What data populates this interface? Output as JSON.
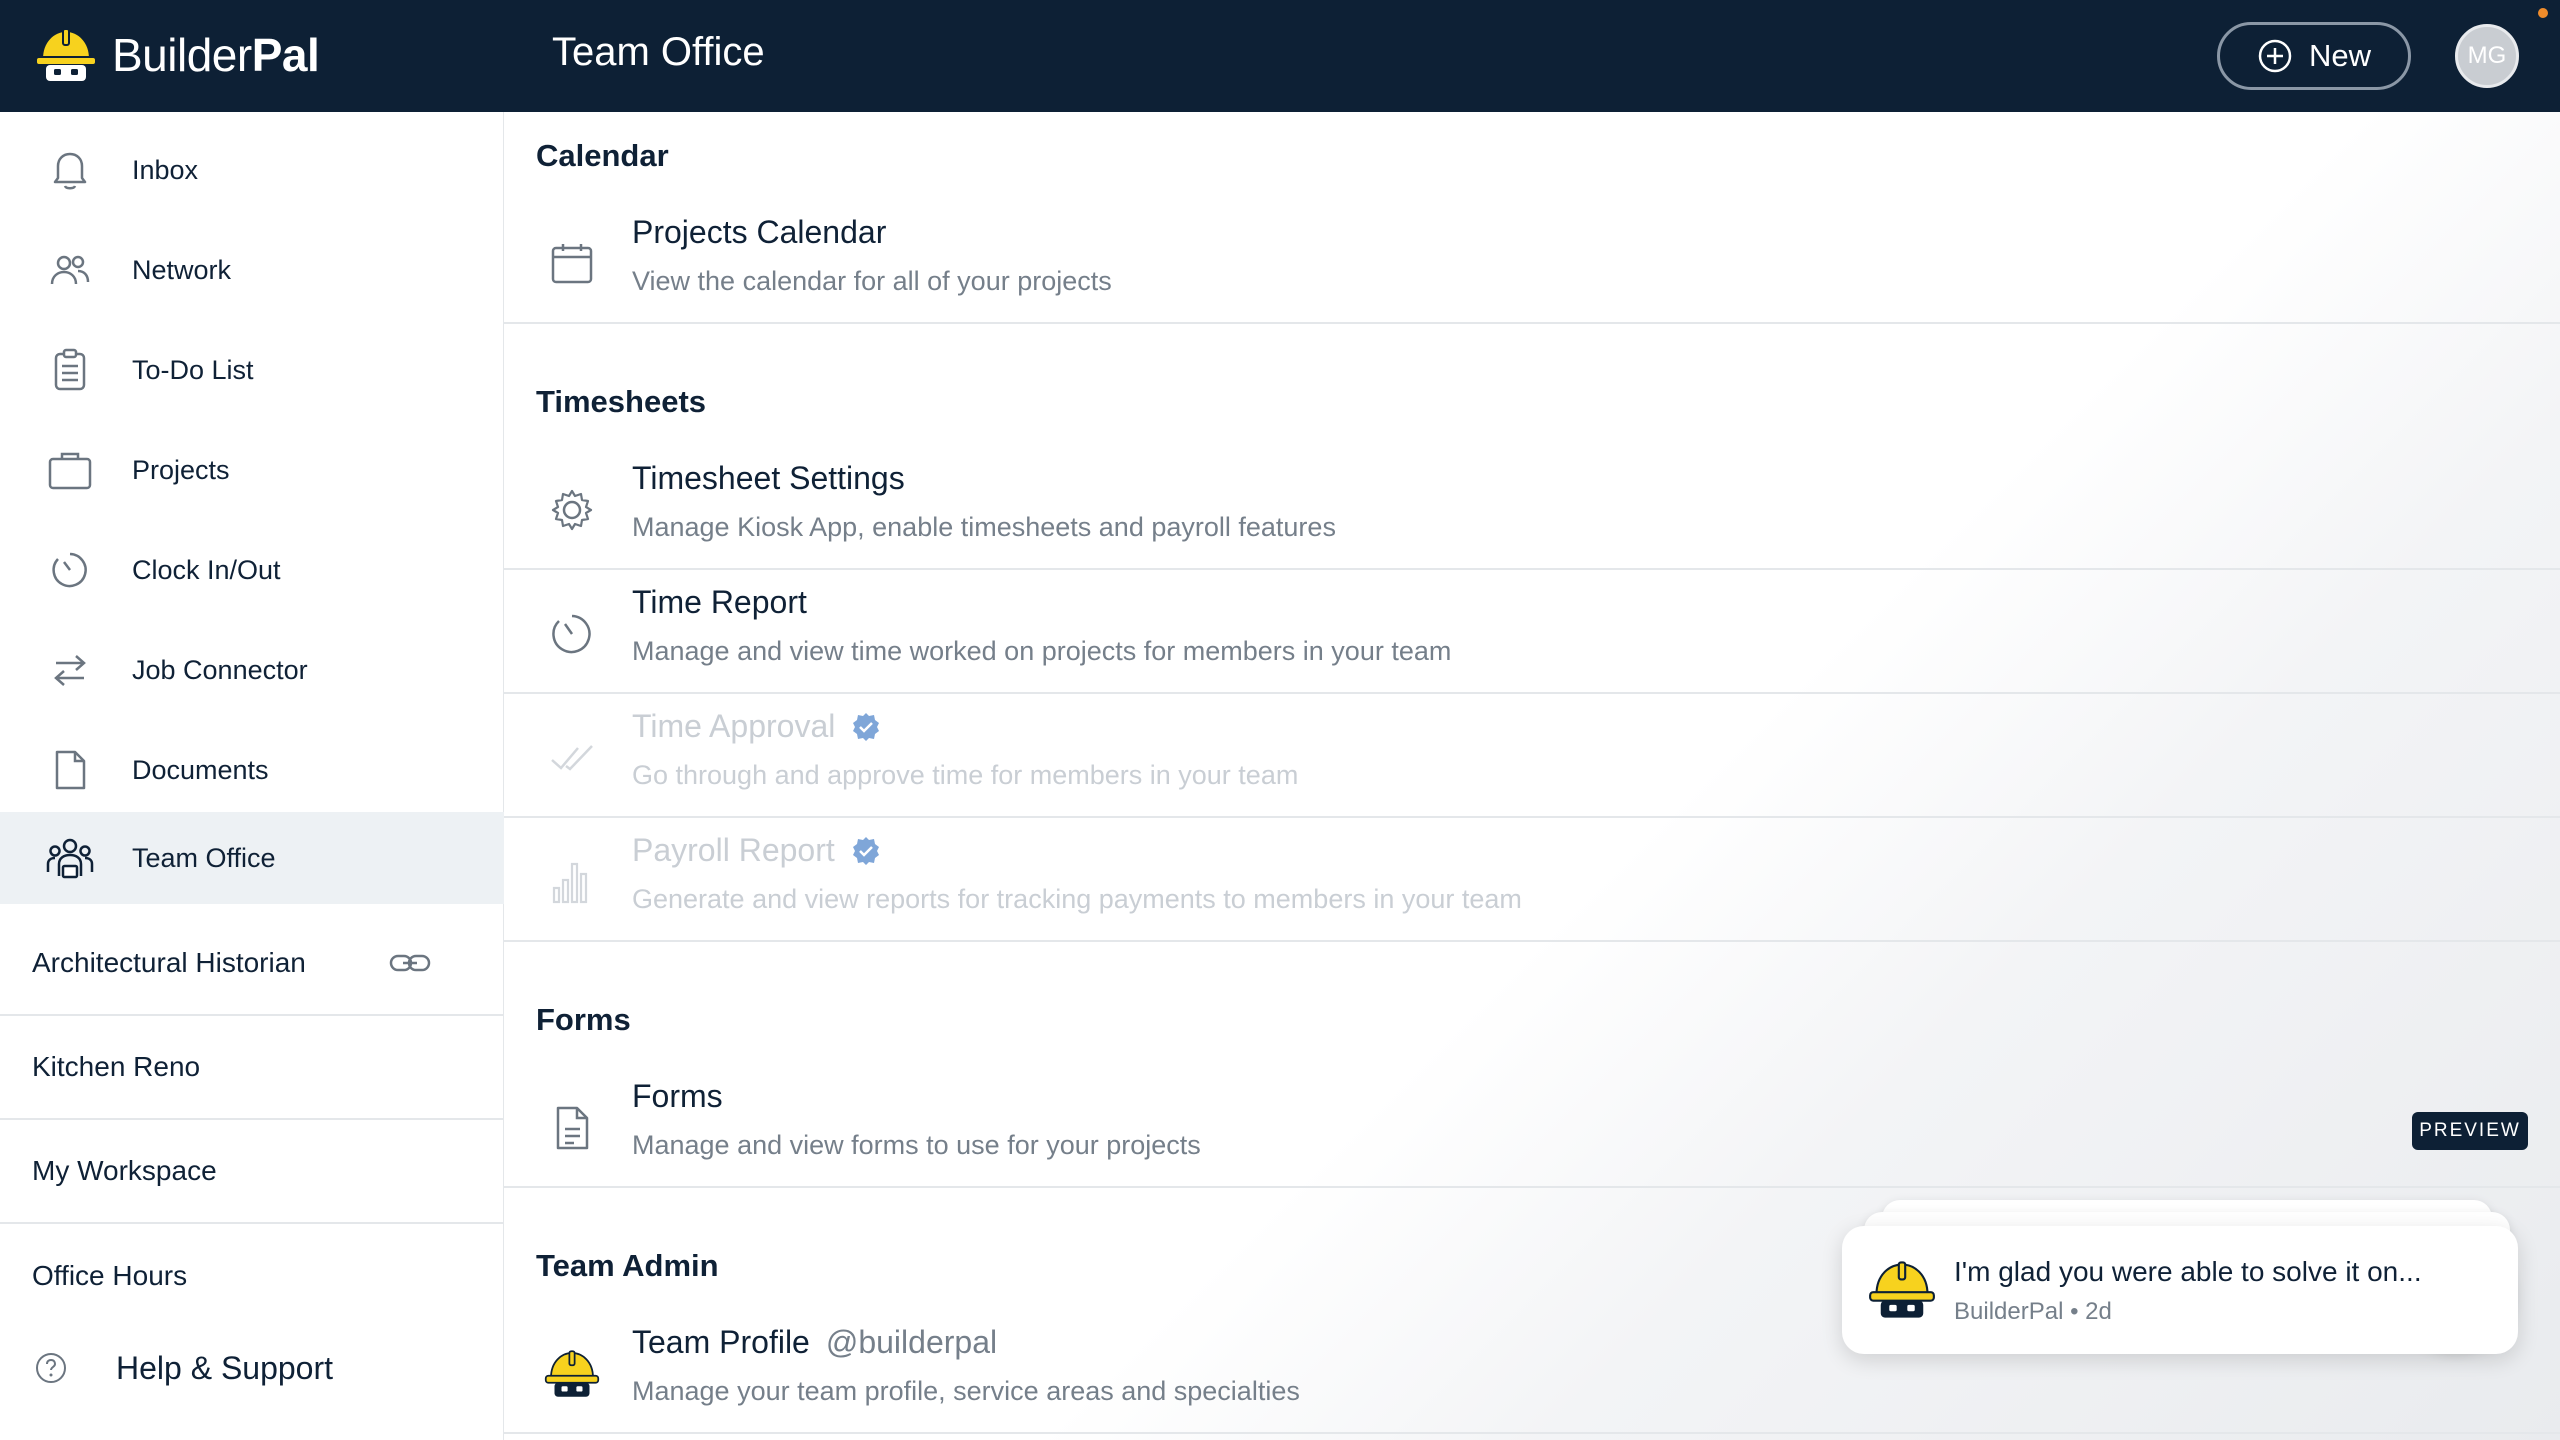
{
  "header": {
    "brand_regular": "Builder",
    "brand_bold": "Pal",
    "title": "Team Office",
    "new_label": "New",
    "avatar_initials": "MG"
  },
  "sidebar": {
    "nav": [
      {
        "label": "Inbox",
        "icon": "bell-icon"
      },
      {
        "label": "Network",
        "icon": "people-icon"
      },
      {
        "label": "To-Do List",
        "icon": "clipboard-icon"
      },
      {
        "label": "Projects",
        "icon": "briefcase-icon"
      },
      {
        "label": "Clock In/Out",
        "icon": "timer-icon"
      },
      {
        "label": "Job Connector",
        "icon": "arrows-icon"
      },
      {
        "label": "Documents",
        "icon": "document-icon"
      },
      {
        "label": "Team Office",
        "icon": "team-icon",
        "active": true
      }
    ],
    "workspaces": [
      {
        "label": "Architectural Historian",
        "linked": true
      },
      {
        "label": "Kitchen Reno"
      },
      {
        "label": "My Workspace"
      },
      {
        "label": "Office Hours"
      }
    ],
    "help_label": "Help & Support"
  },
  "main": {
    "sections": {
      "calendar": "Calendar",
      "timesheets": "Timesheets",
      "forms": "Forms",
      "team_admin": "Team Admin"
    },
    "rows": {
      "projects_calendar": {
        "title": "Projects Calendar",
        "desc": "View the calendar for all of your projects"
      },
      "timesheet_settings": {
        "title": "Timesheet Settings",
        "desc": "Manage Kiosk App, enable timesheets and payroll features"
      },
      "time_report": {
        "title": "Time Report",
        "desc": "Manage and view time worked on projects for members in your team"
      },
      "time_approval": {
        "title": "Time Approval",
        "desc": "Go through and approve time for members in your team"
      },
      "payroll_report": {
        "title": "Payroll Report",
        "desc": "Generate and view reports for tracking payments to members in your team"
      },
      "forms": {
        "title": "Forms",
        "desc": "Manage and view forms to use for your projects",
        "badge": "PREVIEW"
      },
      "team_profile": {
        "title": "Team Profile",
        "handle": "@builderpal",
        "desc": "Manage your team profile, service areas and specialties"
      }
    }
  },
  "toast": {
    "message": "I'm glad you were able to solve it on...",
    "meta": "BuilderPal • 2d"
  },
  "colors": {
    "header_bg": "#0d2035",
    "accent_yellow": "#f7d21e",
    "active_bg": "#edf1f4",
    "muted_text": "#757f8a",
    "verified_blue": "#7fa6d8"
  }
}
